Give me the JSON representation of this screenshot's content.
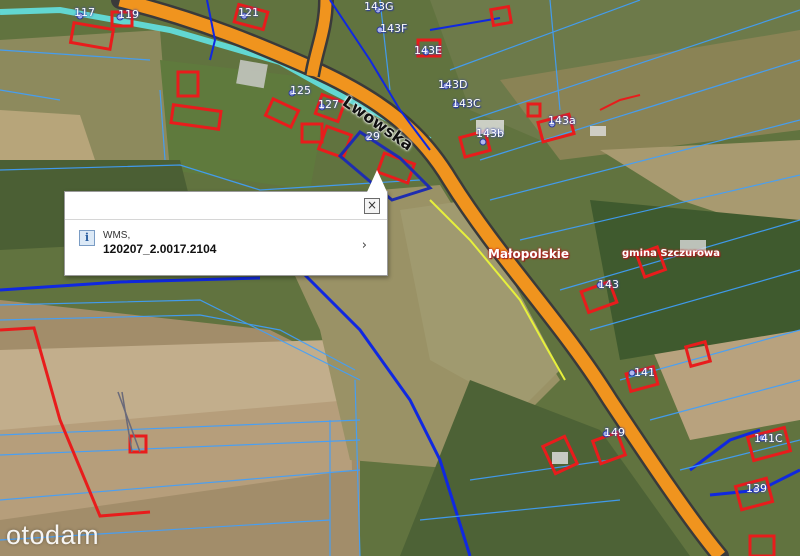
{
  "map": {
    "parcel_labels": [
      "117",
      "119",
      "121",
      "143G",
      "143F",
      "143E",
      "143D",
      "143C",
      "125",
      "127",
      "29",
      "143b",
      "143a",
      "143",
      "141",
      "149",
      "141C",
      "139"
    ],
    "street_name": "Lwowska",
    "region_labels": [
      "Małopolskie",
      "gmina Szczurowa"
    ],
    "colors": {
      "road": "#f0941e",
      "parcel_boundary": "#3fa0ff",
      "building": "#e81c1c",
      "district_line": "#1028e0",
      "selection": "#1e2db0"
    }
  },
  "popup": {
    "close_icon": "close-icon",
    "info_icon": "info-icon",
    "source_label": "WMS,",
    "parcel_id": "120207_2.0017.2104",
    "chevron": "›"
  },
  "watermark": {
    "text": "otodam"
  }
}
